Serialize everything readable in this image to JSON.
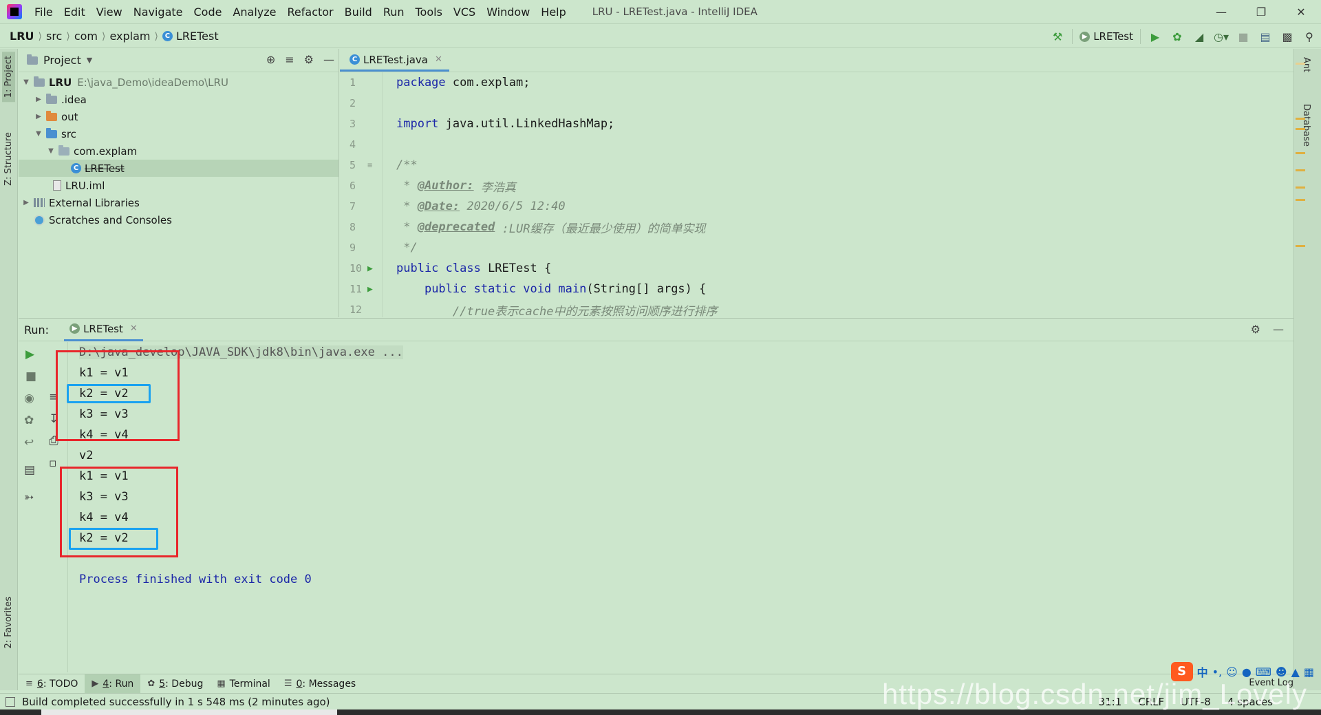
{
  "titlebar": {
    "menu": [
      "File",
      "Edit",
      "View",
      "Navigate",
      "Code",
      "Analyze",
      "Refactor",
      "Build",
      "Run",
      "Tools",
      "VCS",
      "Window",
      "Help"
    ],
    "window_title": "LRU - LRETest.java - IntelliJ IDEA"
  },
  "navbar": {
    "crumbs": [
      "LRU",
      "src",
      "com",
      "explam",
      "LRETest"
    ],
    "run_config": "LRETest"
  },
  "left_strip": {
    "project": "1: Project",
    "structure": "Z: Structure",
    "favorites": "2: Favorites"
  },
  "right_strip": {
    "ant": "Ant",
    "database": "Database"
  },
  "project": {
    "header": "Project",
    "tree": [
      {
        "label": "LRU",
        "path": "E:\\java_Demo\\ideaDemo\\LRU"
      },
      {
        "label": ".idea"
      },
      {
        "label": "out"
      },
      {
        "label": "src"
      },
      {
        "label": "com.explam"
      },
      {
        "label": "LRETest"
      },
      {
        "label": "LRU.iml"
      },
      {
        "label": "External Libraries"
      },
      {
        "label": "Scratches and Consoles"
      }
    ]
  },
  "editor": {
    "tab": "LRETest.java",
    "line_numbers": [
      "1",
      "2",
      "3",
      "4",
      "5",
      "6",
      "7",
      "8",
      "9",
      "10",
      "11",
      "12"
    ],
    "code": {
      "l1_kw": "package",
      "l1_rest": " com.explam;",
      "l3_kw": "import",
      "l3_rest": " java.util.LinkedHashMap;",
      "l5": "/**",
      "l6_star": " * ",
      "l6_tag": "@Author:",
      "l6_text": " 李浩真",
      "l7_star": " * ",
      "l7_tag": "@Date:",
      "l7_text": " 2020/6/5 12:40",
      "l8_star": " * ",
      "l8_tag": "@deprecated",
      "l8_text": " :LUR缓存（最近最少使用）的简单实现",
      "l9": " */",
      "l10_kw": "public class",
      "l10_rest": " LRETest {",
      "l11_indent": "    ",
      "l11_kw": "public static void",
      "l11_fn": " main",
      "l11_rest": "(String[] args) {",
      "l12": "        //true表示cache中的元素按照访问顺序进行排序"
    }
  },
  "run": {
    "label": "Run:",
    "tab": "LRETest",
    "output": [
      "D:\\java_develop\\JAVA_SDK\\jdk8\\bin\\java.exe ...",
      "k1 = v1",
      "k2 = v2",
      "k3 = v3",
      "k4 = v4",
      "v2",
      "k1 = v1",
      "k3 = v3",
      "k4 = v4",
      "k2 = v2",
      "",
      "Process finished with exit code 0"
    ]
  },
  "tool_tabs": [
    {
      "key": "6",
      "label": ": TODO"
    },
    {
      "key": "4",
      "label": ": Run"
    },
    {
      "key": "5",
      "label": ": Debug"
    },
    {
      "key": "",
      "label": "Terminal"
    },
    {
      "key": "0",
      "label": ": Messages"
    }
  ],
  "status": {
    "message": "Build completed successfully in 1 s 548 ms (2 minutes ago)",
    "position": "31:1",
    "line_sep": "CRLF",
    "encoding": "UTF-8",
    "indent": "4 spaces",
    "event_log": "Event Log"
  },
  "watermark": "https://blog.csdn.net/jim_Lovely",
  "ime": {
    "logo": "S",
    "lang": "中"
  },
  "colors": {
    "background": "#cce6cc",
    "keyword": "#1b26a8",
    "highlight_red": "#e8262b",
    "highlight_blue": "#1aa2f0"
  }
}
